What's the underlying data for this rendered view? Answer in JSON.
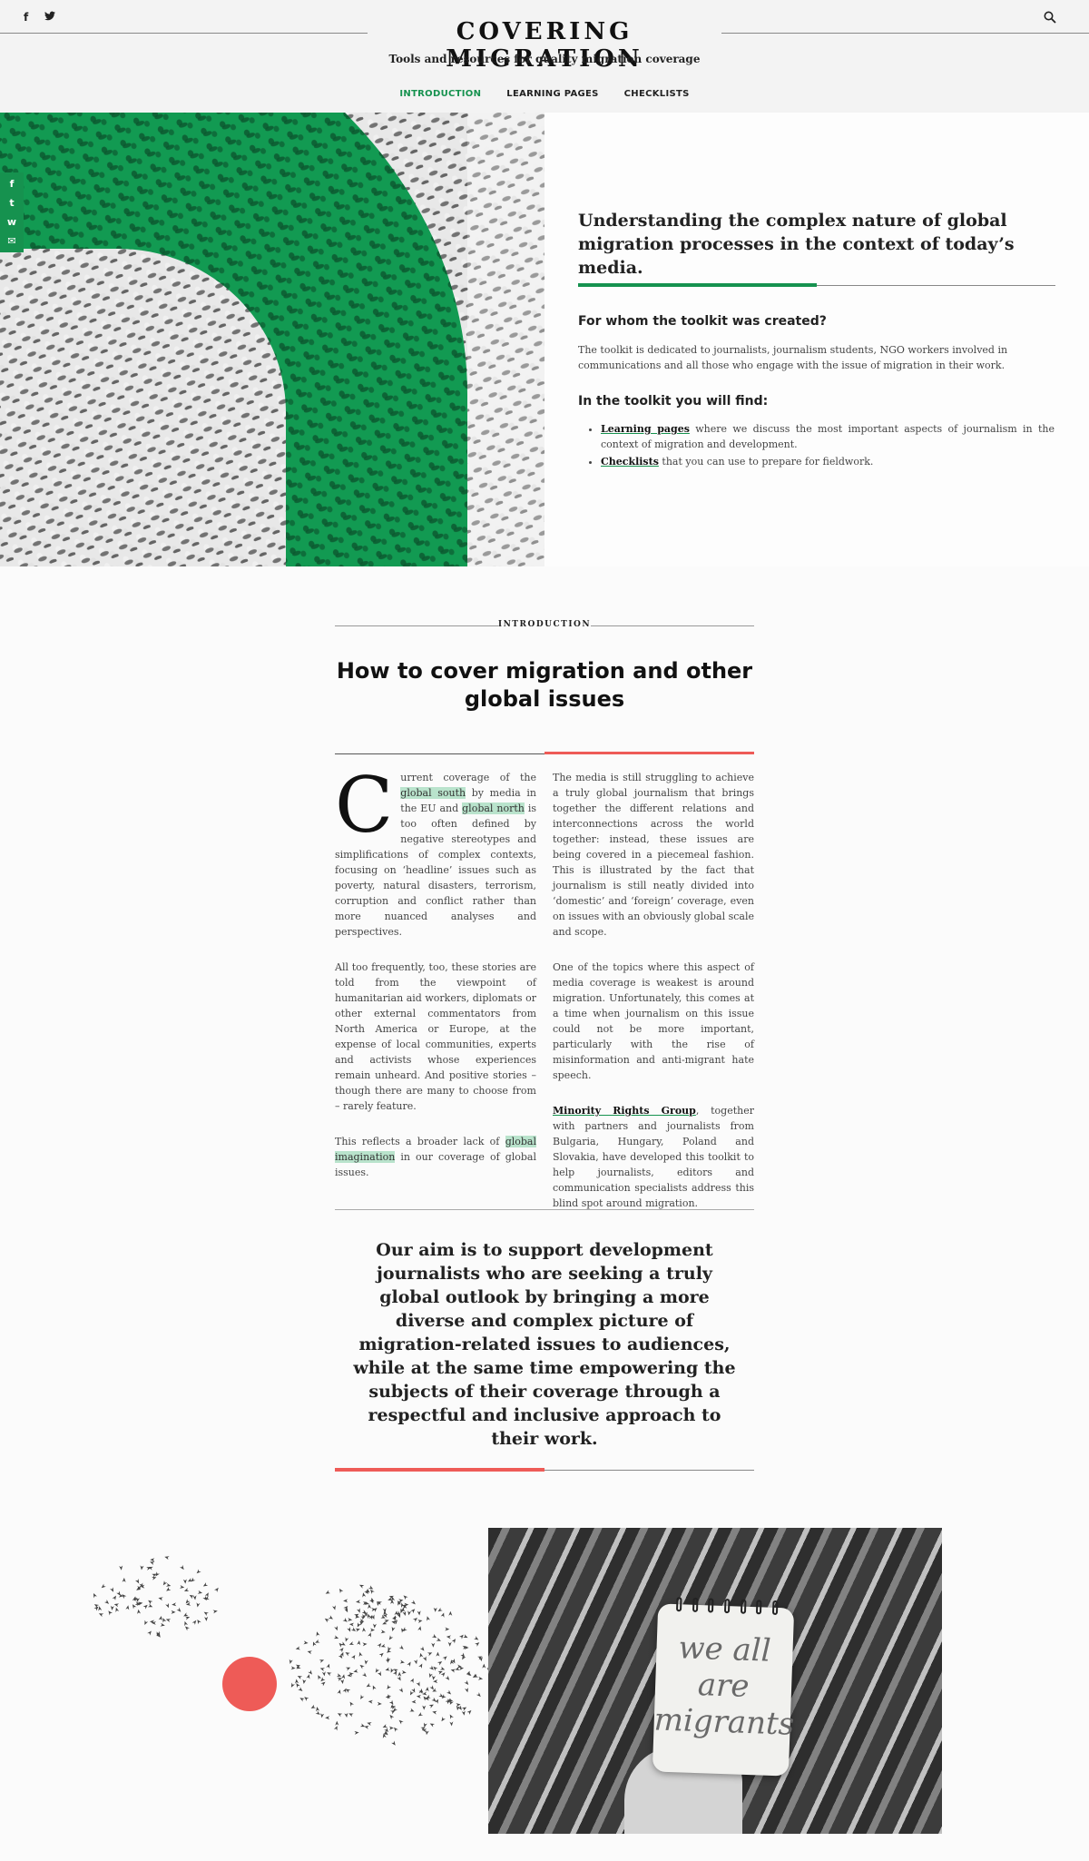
{
  "header": {
    "title": "COVERING MIGRATION",
    "tagline": "Tools and resources for quality migration coverage",
    "social_icons": [
      "facebook-icon",
      "twitter-icon"
    ],
    "facebook_glyph": "f",
    "twitter_glyph": "🐦",
    "search_icon": "search-icon",
    "nav": [
      {
        "label": "INTRODUCTION",
        "active": true
      },
      {
        "label": "LEARNING PAGES",
        "active": false
      },
      {
        "label": "CHECKLISTS",
        "active": false
      }
    ]
  },
  "share": {
    "icons": [
      "facebook-icon",
      "twitter-icon",
      "whatsapp-icon",
      "email-icon"
    ],
    "glyphs": [
      "f",
      "t",
      "w",
      "✉"
    ]
  },
  "hero": {
    "heading": "Understanding the complex nature of global migration processes in the context of today’s media.",
    "for_whom_title": "For whom the toolkit was created?",
    "for_whom_text": "The toolkit is dedicated to journalists, journalism students, NGO workers involved in communications and all those who engage with the issue of migration in their work.",
    "find_title": "In the toolkit you will find:",
    "items": [
      {
        "link": "Learning pages",
        "text": " where we discuss the most important aspects of journalism in the context of migration and development."
      },
      {
        "link": "Checklists",
        "text": " that you can use to prepare for fieldwork."
      }
    ]
  },
  "intro": {
    "label": "INTRODUCTION",
    "title": "How to cover migration and other global issues",
    "p1_dropcap": "C",
    "p1_a": "urrent coverage of the ",
    "p1_hl1": "global south",
    "p1_b": " by media in the EU and ",
    "p1_hl2": "global north",
    "p1_c": " is too often defined by negative stereotypes and simplifications of complex contexts, focusing on ‘headline’ issues such as poverty, natural disasters, terrorism, corruption and conflict rather than more nuanced analyses and perspectives.",
    "p2": "All too frequently, too, these stories are told from the viewpoint of humanitarian aid workers, diplomats or other external commentators from North America or Europe, at the expense of local communities, experts and activists whose experiences remain unheard. And positive stories – though there are many to choose from – rarely feature.",
    "p3_a": "This reflects a broader lack of ",
    "p3_hl": "global imagination",
    "p3_b": " in our coverage of global issues.",
    "p4": "The media is still struggling to achieve a truly global journalism that brings together the different relations and interconnections across the world together: instead, these issues are being covered in a piecemeal fashion. This is illustrated by the fact that journalism is still neatly divided into ‘domestic’ and ‘foreign’ coverage, even on issues with an obviously global scale and scope.",
    "p5": "One of the topics where this aspect of media coverage is weakest is around migration. Unfortunately, this comes at a time when journalism on this issue could not be more important, particularly with the rise of misinformation and anti-migrant hate speech.",
    "p6_link": "Minority Rights Group",
    "p6_text": ", together with partners and journalists from Bulgaria, Hungary, Poland and Slovakia, have developed this toolkit to help journalists, editors and communication specialists address this blind spot around migration."
  },
  "quote": {
    "text": "Our aim is to support development journalists who are seeking a truly global outlook by bringing a more diverse and complex picture of migration-related issues to audiences, while at the same time empowering the subjects of their coverage through a respectful and inclusive approach to their work."
  },
  "photo": {
    "note_line1": "we all",
    "note_line2": "are",
    "note_line3": "migrants"
  },
  "colors": {
    "accent_green": "#16924f",
    "accent_red": "#ee5b57",
    "highlight": "#b9e3cc"
  }
}
